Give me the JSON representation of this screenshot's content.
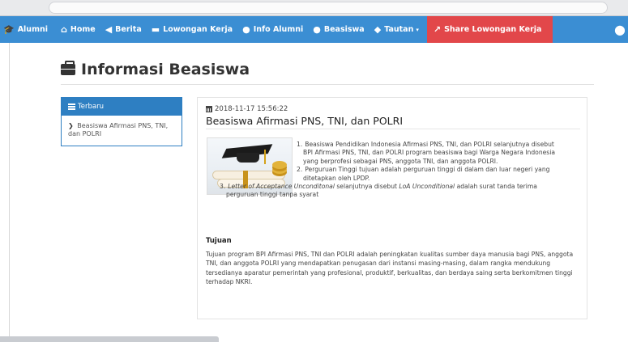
{
  "navbar": {
    "brand": "Alumni",
    "items": [
      {
        "label": "Home",
        "icon": "home-icon"
      },
      {
        "label": "Berita",
        "icon": "bullhorn-icon"
      },
      {
        "label": "Lowongan Kerja",
        "icon": "briefcase-icon"
      },
      {
        "label": "Info Alumni",
        "icon": "user-icon"
      },
      {
        "label": "Beasiswa",
        "icon": "user-icon"
      },
      {
        "label": "Tautan",
        "icon": "tag-icon"
      }
    ],
    "share_label": "Share Lowongan Kerja",
    "colors": {
      "bar": "#3b8ed3",
      "share": "#e2474a"
    }
  },
  "page": {
    "title": "Informasi Beasiswa"
  },
  "sidebar": {
    "heading": "Terbaru",
    "links": [
      {
        "label": "Beasiswa Afirmasi PNS, TNI, dan POLRI"
      }
    ]
  },
  "article": {
    "date": "2018-11-17 15:56:22",
    "title": "Beasiswa Afirmasi PNS, TNI, dan POLRI",
    "items": [
      {
        "num": "1.",
        "lines": [
          "Beasiswa Pendidikan Indonesia Afirmasi PNS, TNI, dan POLRI selanjutnya disebut",
          "BPI Afirmasi PNS, TNI, dan POLRI program beasiswa bagi Warga Negara Indonesia",
          "yang berprofesi sebagai PNS, anggota TNI, dan anggota POLRI."
        ]
      },
      {
        "num": "2.",
        "lines": [
          "Perguruan Tinggi tujuan adalah perguruan tinggi di dalam dan luar negeri yang",
          "ditetapkan oleh LPDP."
        ]
      },
      {
        "num": "3.",
        "em1": "Letter of Acceptance Unconditonal",
        "mid": " selanjutnya disebut ",
        "em2": "LoA Unconditional",
        "tail": " adalah surat tanda terima",
        "line2": "perguruan tinggi tanpa syarat"
      }
    ],
    "section_title": "Tujuan",
    "section_body": "Tujuan program BPI Afirmasi PNS, TNI dan POLRI adalah peningkatan kualitas sumber daya manusia bagi PNS, anggota TNI, dan anggota POLRI yang mendapatkan penugasan dari instansi masing-masing, dalam rangka mendukung tersedianya aparatur pemerintah yang profesional, produktif, berkualitas, dan berdaya saing serta berkomitmen tinggi terhadap NKRI."
  }
}
